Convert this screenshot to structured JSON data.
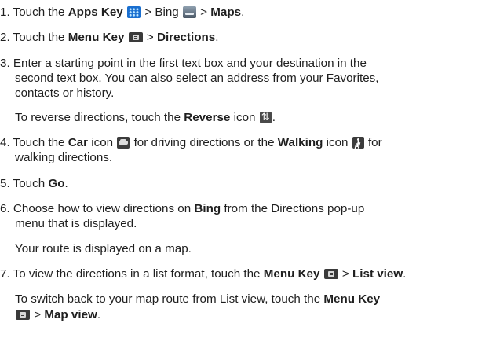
{
  "steps": [
    {
      "num": "1.",
      "a": "Touch the ",
      "b1": "Apps Key",
      "c": " > ",
      "b2": "Bing",
      "d": " > ",
      "b3": "Maps",
      "e": "."
    },
    {
      "num": "2.",
      "a": "Touch the ",
      "b1": "Menu Key",
      "c": " > ",
      "b2": "Directions",
      "d": "."
    },
    {
      "num": "3.",
      "l1": "Enter a starting point in the first text box and your destination in the",
      "l2": "second text box. You can also select an address from your Favorites,",
      "l3": "contacts or history.",
      "note_a": "To reverse directions, touch the ",
      "note_b": "Reverse",
      "note_c": " icon ",
      "note_d": "."
    },
    {
      "num": "4.",
      "a": "Touch the ",
      "b1": "Car",
      "c": " icon ",
      "d": " for driving directions or the ",
      "b2": "Walking",
      "e": " icon ",
      "f": " for",
      "l2": "walking directions."
    },
    {
      "num": "5.",
      "a": "Touch ",
      "b1": "Go",
      "e": "."
    },
    {
      "num": "6.",
      "a": "Choose how to view directions on ",
      "b1": "Bing",
      "c": " from the Directions pop-up",
      "l2": "menu that is displayed.",
      "note": "Your route is displayed on a map."
    },
    {
      "num": "7.",
      "a": "To view the directions in a list format, touch the ",
      "b1": "Menu Key",
      "c": " > ",
      "b2": "List view",
      "e": ".",
      "note_a": "To switch back to your map route from List view, touch the ",
      "note_b": "Menu Key",
      "note2_a": " > ",
      "note2_b": "Map view",
      "note2_c": "."
    }
  ],
  "icons": {
    "apps": "apps-key-icon",
    "bing": "bing-icon",
    "menu": "menu-key-icon",
    "reverse": "reverse-icon",
    "car": "car-icon",
    "walking": "walking-icon"
  }
}
